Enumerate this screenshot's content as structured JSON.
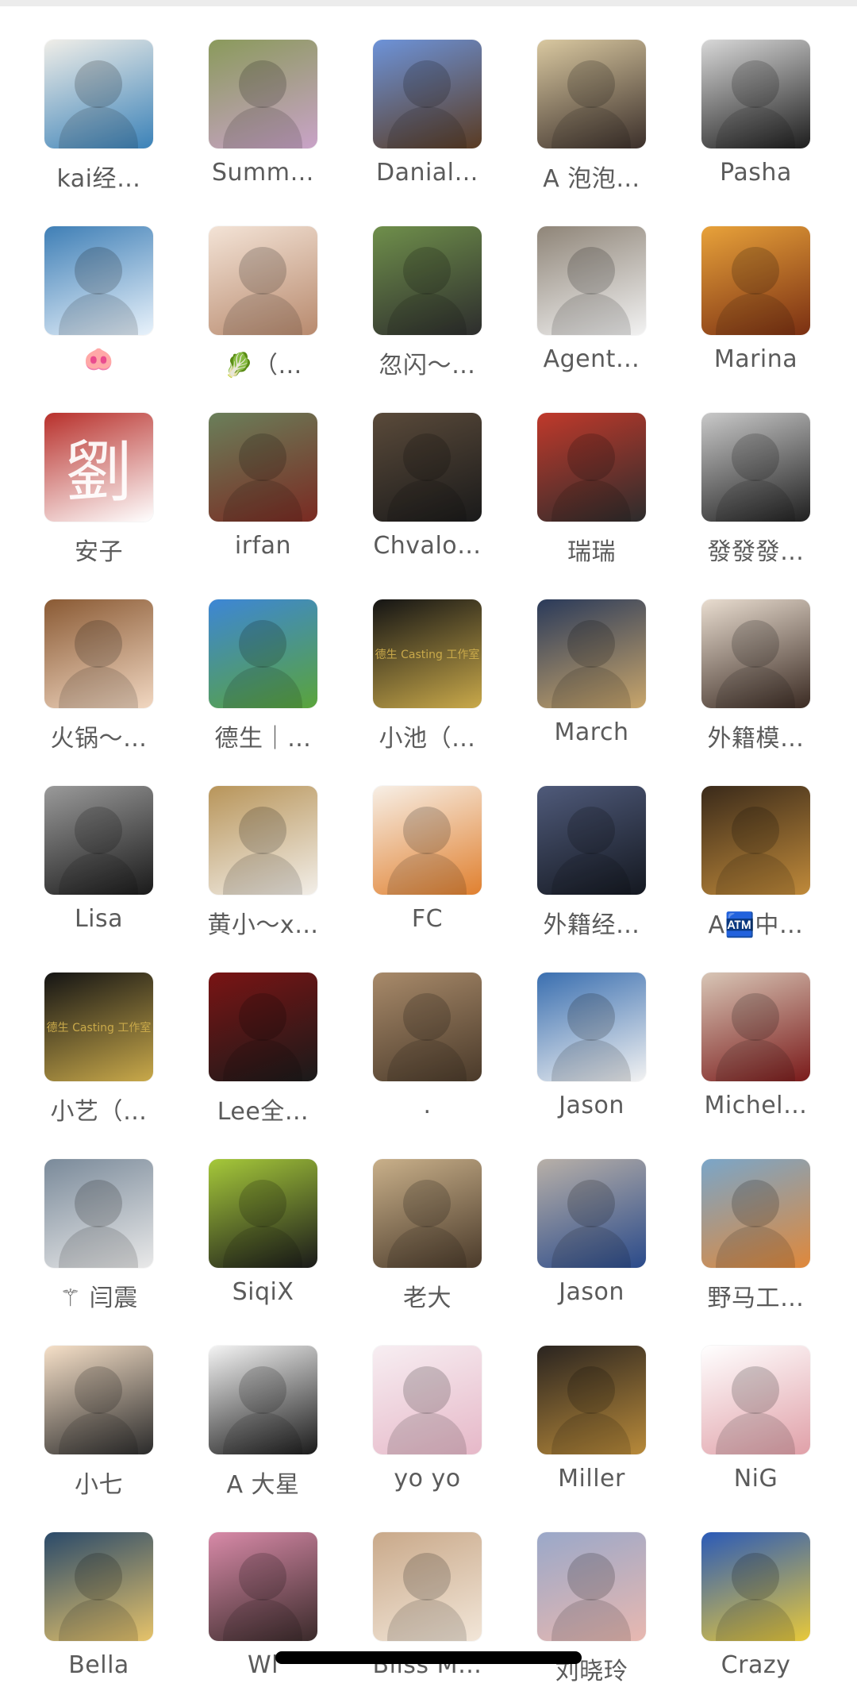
{
  "contacts": [
    {
      "name": "kai经…",
      "avatar": "portrait-sketch",
      "c1": "#f0eee8",
      "c2": "#3b82b8",
      "glyph": ""
    },
    {
      "name": "Summ…",
      "avatar": "woman-on-grass",
      "c1": "#8a9a5b",
      "c2": "#c9a3c8",
      "glyph": ""
    },
    {
      "name": "Danial…",
      "avatar": "eagle",
      "c1": "#6d93d9",
      "c2": "#5a3b22",
      "glyph": ""
    },
    {
      "name": "A 泡泡…",
      "avatar": "couple-selfie",
      "c1": "#d9c8a0",
      "c2": "#3b2f2a",
      "glyph": ""
    },
    {
      "name": "Pasha",
      "avatar": "man-on-stairs",
      "c1": "#d8d8d8",
      "c2": "#1d1d1d",
      "glyph": ""
    },
    {
      "name": "🐽",
      "avatar": "woman-at-sea",
      "c1": "#3f7fb6",
      "c2": "#e8f2fb",
      "glyph": ""
    },
    {
      "name": "🥬（…",
      "avatar": "girl-white-hat",
      "c1": "#f3e3d6",
      "c2": "#b88a6e",
      "glyph": ""
    },
    {
      "name": "忽闪～…",
      "avatar": "jumping-person",
      "c1": "#6f8f4b",
      "c2": "#2d2d2d",
      "glyph": ""
    },
    {
      "name": "Agent…",
      "avatar": "man-seated-street",
      "c1": "#8f8578",
      "c2": "#f2f2f2",
      "glyph": ""
    },
    {
      "name": "Marina",
      "avatar": "woman-warm-light",
      "c1": "#e8a23a",
      "c2": "#7a2f12",
      "glyph": ""
    },
    {
      "name": "安子",
      "avatar": "red-seal",
      "c1": "#b8302b",
      "c2": "#ffffff",
      "glyph": "劉"
    },
    {
      "name": "irfan",
      "avatar": "man-mountains",
      "c1": "#6a7f5a",
      "c2": "#7a2a22",
      "glyph": ""
    },
    {
      "name": "Chvalo…",
      "avatar": "woman-dark-dress",
      "c1": "#5a4a3a",
      "c2": "#1a1a1a",
      "glyph": ""
    },
    {
      "name": "瑞瑞",
      "avatar": "man-red-wall",
      "c1": "#c0392b",
      "c2": "#2c2c2c",
      "glyph": ""
    },
    {
      "name": "發發發…",
      "avatar": "woman-gallery",
      "c1": "#c9c9c9",
      "c2": "#1f1f1f",
      "glyph": ""
    },
    {
      "name": "火锅～…",
      "avatar": "girl-curly-hair",
      "c1": "#8a5a34",
      "c2": "#f1d7c1",
      "glyph": ""
    },
    {
      "name": "德生｜…",
      "avatar": "jumping-meadow",
      "c1": "#3d86d6",
      "c2": "#5aa43a",
      "glyph": ""
    },
    {
      "name": "小池（…",
      "avatar": "casting-logo-dark",
      "c1": "#141414",
      "c2": "#c9a94a",
      "glyph": "德生 Casting 工作室"
    },
    {
      "name": "March",
      "avatar": "man-city-night",
      "c1": "#2a3a5a",
      "c2": "#c9a66b",
      "glyph": ""
    },
    {
      "name": "外籍模…",
      "avatar": "woman-beige",
      "c1": "#e9ddd0",
      "c2": "#3a2a22",
      "glyph": ""
    },
    {
      "name": "Lisa",
      "avatar": "woman-bw-film",
      "c1": "#9a9a9a",
      "c2": "#1a1a1a",
      "glyph": ""
    },
    {
      "name": "黄小～x…",
      "avatar": "shop-shelves",
      "c1": "#b8955a",
      "c2": "#f2eee8",
      "glyph": ""
    },
    {
      "name": "FC",
      "avatar": "cartoon-blonde-girl",
      "c1": "#f7efe6",
      "c2": "#e0802f",
      "glyph": ""
    },
    {
      "name": "外籍经…",
      "avatar": "silhouette-blue",
      "c1": "#4f5a7a",
      "c2": "#141820",
      "glyph": ""
    },
    {
      "name": "A🏧中…",
      "avatar": "poster-man",
      "c1": "#3a2a1a",
      "c2": "#c08a3a",
      "glyph": ""
    },
    {
      "name": "小艺（…",
      "avatar": "casting-logo-dark-2",
      "c1": "#141414",
      "c2": "#c9a94a",
      "glyph": "德生 Casting 工作室"
    },
    {
      "name": "Lee全…",
      "avatar": "man-red-backdrop",
      "c1": "#7a1414",
      "c2": "#1a1a1a",
      "glyph": ""
    },
    {
      "name": ".",
      "avatar": "painting-woman",
      "c1": "#a88a6a",
      "c2": "#4a3a2a",
      "glyph": ""
    },
    {
      "name": "Jason",
      "avatar": "white-sports-car",
      "c1": "#3a6fb0",
      "c2": "#f2f2f2",
      "glyph": ""
    },
    {
      "name": "Michel…",
      "avatar": "woman-flowers",
      "c1": "#d8c6b6",
      "c2": "#7a1a1a",
      "glyph": ""
    },
    {
      "name": "⚚ 闫震",
      "avatar": "man-car-window",
      "c1": "#7a8a9a",
      "c2": "#e9e9e9",
      "glyph": ""
    },
    {
      "name": "SiqiX",
      "avatar": "cartoon-cat-girl",
      "c1": "#a6c93a",
      "c2": "#1a1a1a",
      "glyph": ""
    },
    {
      "name": "老大",
      "avatar": "astronaut-sepia",
      "c1": "#c9b08a",
      "c2": "#4a3a2a",
      "glyph": ""
    },
    {
      "name": "Jason",
      "avatar": "street-vending",
      "c1": "#b8b0a8",
      "c2": "#2a4a8a",
      "glyph": ""
    },
    {
      "name": "野马工…",
      "avatar": "fish-landscape",
      "c1": "#7aa6c9",
      "c2": "#e0883a",
      "glyph": ""
    },
    {
      "name": "小七",
      "avatar": "cartoon-maruko",
      "c1": "#f6e0c8",
      "c2": "#2a2a2a",
      "glyph": ""
    },
    {
      "name": "A  大星",
      "avatar": "man-suit-white",
      "c1": "#f4f4f4",
      "c2": "#1a1a1a",
      "glyph": ""
    },
    {
      "name": "yo yo",
      "avatar": "anime-girl",
      "c1": "#f7eef2",
      "c2": "#e6b8c8",
      "glyph": ""
    },
    {
      "name": "Miller",
      "avatar": "wolf-gold",
      "c1": "#2a2420",
      "c2": "#b88a3a",
      "glyph": ""
    },
    {
      "name": "NiG",
      "avatar": "bulldog-cartoon",
      "c1": "#ffffff",
      "c2": "#e0a0a8",
      "glyph": ""
    },
    {
      "name": "Bella",
      "avatar": "blonde-man-denim",
      "c1": "#2a4a6a",
      "c2": "#e6c36a",
      "glyph": ""
    },
    {
      "name": "Wl",
      "avatar": "pink-shirt",
      "c1": "#d88aa8",
      "c2": "#3a2a2a",
      "glyph": ""
    },
    {
      "name": "Bliss M…",
      "avatar": "blonde-woman",
      "c1": "#c9a98a",
      "c2": "#f2e6d8",
      "glyph": ""
    },
    {
      "name": "刘晓玲",
      "avatar": "woman-pink-top",
      "c1": "#9aa8c9",
      "c2": "#e8b8b0",
      "glyph": ""
    },
    {
      "name": "Crazy",
      "avatar": "helmet-racer",
      "c1": "#2a5ab8",
      "c2": "#e8c93a",
      "glyph": ""
    }
  ]
}
